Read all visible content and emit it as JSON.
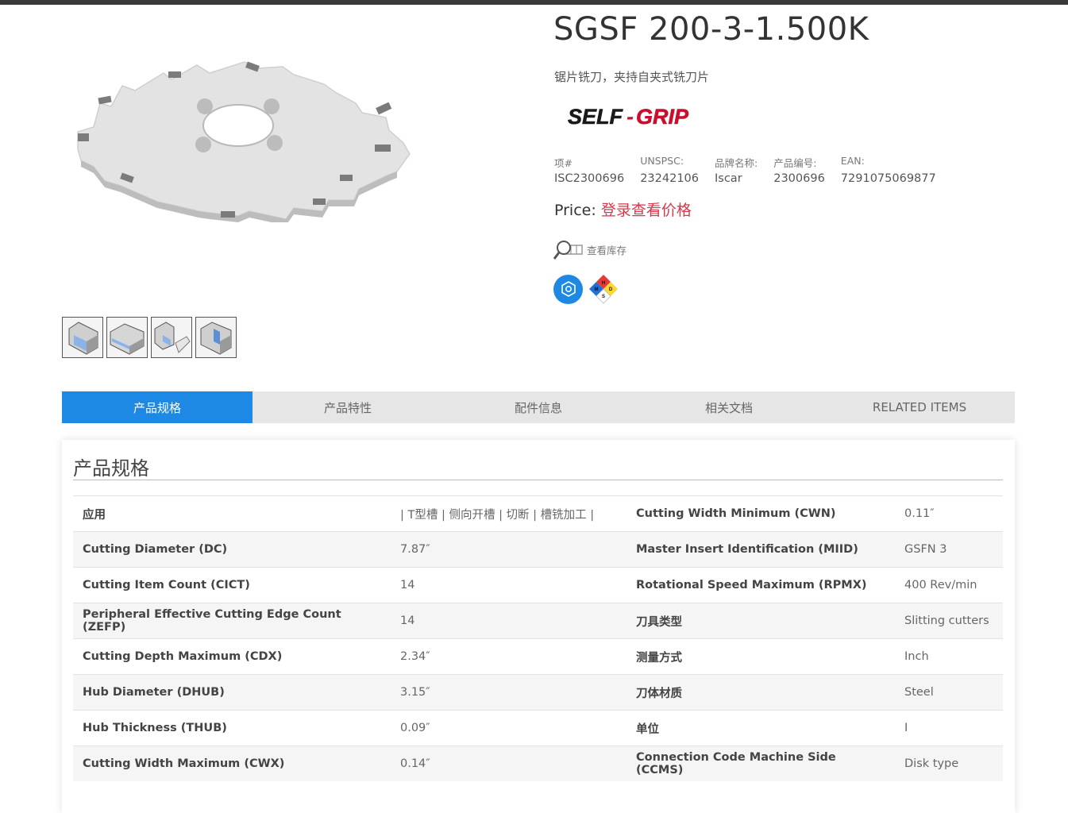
{
  "product": {
    "title": "SGSF 200-3-1.500K",
    "subtitle": "锯片铣刀，夹持自夹式铣刀片",
    "brand_logo_text": "SELF-GRIP",
    "meta": [
      {
        "label": "项#",
        "value": "ISC2300696"
      },
      {
        "label": "UNSPSC:",
        "value": "23242106"
      },
      {
        "label": "品牌名称:",
        "value": "Iscar"
      },
      {
        "label": "产品编号:",
        "value": "2300696"
      },
      {
        "label": "EAN:",
        "value": "7291075069877"
      }
    ],
    "price_label": "Price:",
    "price_link": "登录查看价格",
    "stock_label": "查看库存",
    "msds_letters": {
      "top": "H",
      "left": "M",
      "right": "D",
      "bottom": "S"
    }
  },
  "tabs": [
    {
      "label": "产品规格",
      "active": true
    },
    {
      "label": "产品特性",
      "active": false
    },
    {
      "label": "配件信息",
      "active": false
    },
    {
      "label": "相关文档",
      "active": false
    },
    {
      "label": "RELATED ITEMS",
      "active": false
    }
  ],
  "specs": {
    "title": "产品规格",
    "rows": [
      {
        "k1": "应用",
        "v1": "| T型槽 | 侧向开槽 | 切断 | 槽铣加工 |",
        "k2": "Cutting Width Minimum (CWN)",
        "v2": "0.11″"
      },
      {
        "k1": "Cutting Diameter (DC)",
        "v1": "7.87″",
        "k2": "Master Insert Identification (MIID)",
        "v2": "GSFN 3"
      },
      {
        "k1": "Cutting Item Count (CICT)",
        "v1": "14",
        "k2": "Rotational Speed Maximum (RPMX)",
        "v2": "400 Rev/min"
      },
      {
        "k1": "Peripheral Effective Cutting Edge Count (ZEFP)",
        "v1": "14",
        "k2": "刀具类型",
        "v2": "Slitting cutters"
      },
      {
        "k1": "Cutting Depth Maximum (CDX)",
        "v1": "2.34″",
        "k2": "测量方式",
        "v2": "Inch"
      },
      {
        "k1": "Hub Diameter (DHUB)",
        "v1": "3.15″",
        "k2": "刀体材质",
        "v2": "Steel"
      },
      {
        "k1": "Hub Thickness (THUB)",
        "v1": "0.09″",
        "k2": "单位",
        "v2": "I"
      },
      {
        "k1": "Cutting Width Maximum (CWX)",
        "v1": "0.14″",
        "k2": "Connection Code Machine Side (CCMS)",
        "v2": "Disk type"
      }
    ]
  },
  "colors": {
    "accent": "#1e88e5",
    "price_link": "#d9364a",
    "topbar": "#3a3a3a"
  }
}
